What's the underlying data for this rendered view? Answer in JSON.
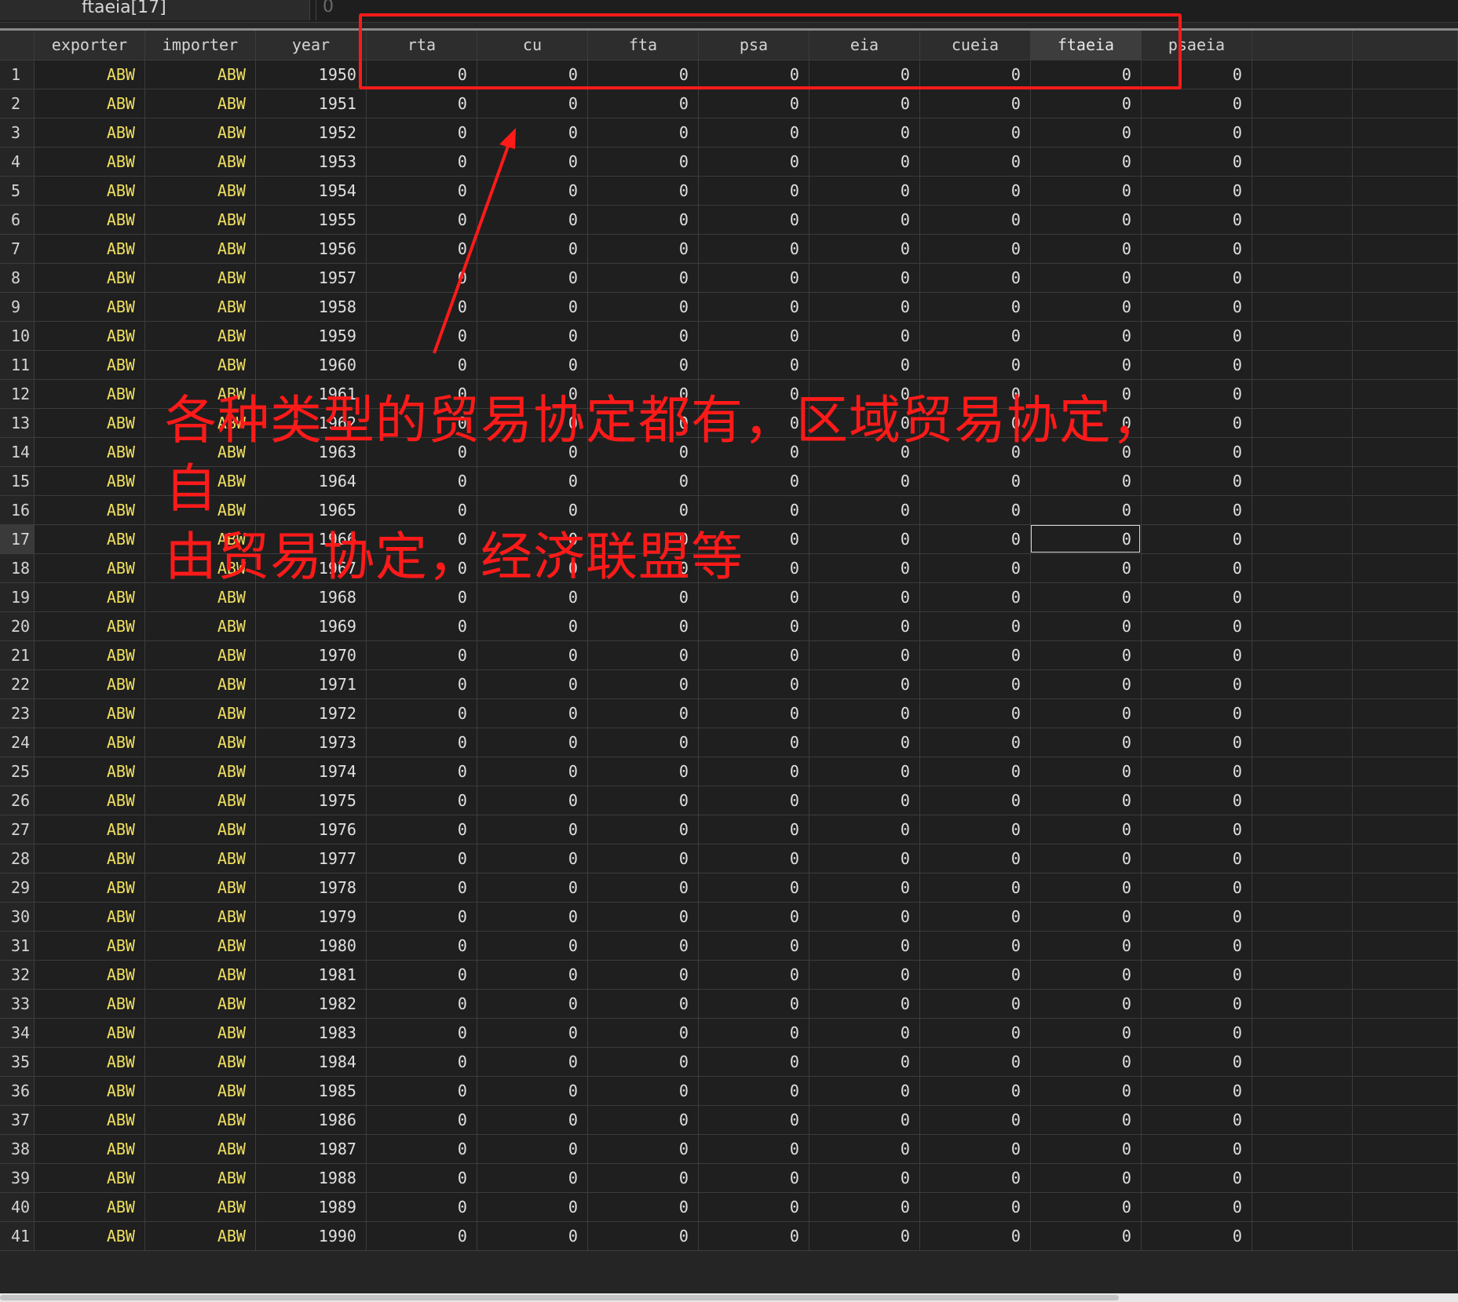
{
  "varname_label": "ftaeia[17]",
  "cell_value": "0",
  "columns": [
    "",
    "exporter",
    "importer",
    "year",
    "rta",
    "cu",
    "fta",
    "psa",
    "eia",
    "cueia",
    "ftaeia",
    "psaeia",
    "",
    ""
  ],
  "selected_column": "ftaeia",
  "selected_row": 17,
  "rows": [
    {
      "n": "1",
      "exporter": "ABW",
      "importer": "ABW",
      "year": "1950",
      "rta": "0",
      "cu": "0",
      "fta": "0",
      "psa": "0",
      "eia": "0",
      "cueia": "0",
      "ftaeia": "0",
      "psaeia": "0"
    },
    {
      "n": "2",
      "exporter": "ABW",
      "importer": "ABW",
      "year": "1951",
      "rta": "0",
      "cu": "0",
      "fta": "0",
      "psa": "0",
      "eia": "0",
      "cueia": "0",
      "ftaeia": "0",
      "psaeia": "0"
    },
    {
      "n": "3",
      "exporter": "ABW",
      "importer": "ABW",
      "year": "1952",
      "rta": "0",
      "cu": "0",
      "fta": "0",
      "psa": "0",
      "eia": "0",
      "cueia": "0",
      "ftaeia": "0",
      "psaeia": "0"
    },
    {
      "n": "4",
      "exporter": "ABW",
      "importer": "ABW",
      "year": "1953",
      "rta": "0",
      "cu": "0",
      "fta": "0",
      "psa": "0",
      "eia": "0",
      "cueia": "0",
      "ftaeia": "0",
      "psaeia": "0"
    },
    {
      "n": "5",
      "exporter": "ABW",
      "importer": "ABW",
      "year": "1954",
      "rta": "0",
      "cu": "0",
      "fta": "0",
      "psa": "0",
      "eia": "0",
      "cueia": "0",
      "ftaeia": "0",
      "psaeia": "0"
    },
    {
      "n": "6",
      "exporter": "ABW",
      "importer": "ABW",
      "year": "1955",
      "rta": "0",
      "cu": "0",
      "fta": "0",
      "psa": "0",
      "eia": "0",
      "cueia": "0",
      "ftaeia": "0",
      "psaeia": "0"
    },
    {
      "n": "7",
      "exporter": "ABW",
      "importer": "ABW",
      "year": "1956",
      "rta": "0",
      "cu": "0",
      "fta": "0",
      "psa": "0",
      "eia": "0",
      "cueia": "0",
      "ftaeia": "0",
      "psaeia": "0"
    },
    {
      "n": "8",
      "exporter": "ABW",
      "importer": "ABW",
      "year": "1957",
      "rta": "0",
      "cu": "0",
      "fta": "0",
      "psa": "0",
      "eia": "0",
      "cueia": "0",
      "ftaeia": "0",
      "psaeia": "0"
    },
    {
      "n": "9",
      "exporter": "ABW",
      "importer": "ABW",
      "year": "1958",
      "rta": "0",
      "cu": "0",
      "fta": "0",
      "psa": "0",
      "eia": "0",
      "cueia": "0",
      "ftaeia": "0",
      "psaeia": "0"
    },
    {
      "n": "10",
      "exporter": "ABW",
      "importer": "ABW",
      "year": "1959",
      "rta": "0",
      "cu": "0",
      "fta": "0",
      "psa": "0",
      "eia": "0",
      "cueia": "0",
      "ftaeia": "0",
      "psaeia": "0"
    },
    {
      "n": "11",
      "exporter": "ABW",
      "importer": "ABW",
      "year": "1960",
      "rta": "0",
      "cu": "0",
      "fta": "0",
      "psa": "0",
      "eia": "0",
      "cueia": "0",
      "ftaeia": "0",
      "psaeia": "0"
    },
    {
      "n": "12",
      "exporter": "ABW",
      "importer": "ABW",
      "year": "1961",
      "rta": "0",
      "cu": "0",
      "fta": "0",
      "psa": "0",
      "eia": "0",
      "cueia": "0",
      "ftaeia": "0",
      "psaeia": "0"
    },
    {
      "n": "13",
      "exporter": "ABW",
      "importer": "ABW",
      "year": "1962",
      "rta": "0",
      "cu": "0",
      "fta": "0",
      "psa": "0",
      "eia": "0",
      "cueia": "0",
      "ftaeia": "0",
      "psaeia": "0"
    },
    {
      "n": "14",
      "exporter": "ABW",
      "importer": "ABW",
      "year": "1963",
      "rta": "0",
      "cu": "0",
      "fta": "0",
      "psa": "0",
      "eia": "0",
      "cueia": "0",
      "ftaeia": "0",
      "psaeia": "0"
    },
    {
      "n": "15",
      "exporter": "ABW",
      "importer": "ABW",
      "year": "1964",
      "rta": "0",
      "cu": "0",
      "fta": "0",
      "psa": "0",
      "eia": "0",
      "cueia": "0",
      "ftaeia": "0",
      "psaeia": "0"
    },
    {
      "n": "16",
      "exporter": "ABW",
      "importer": "ABW",
      "year": "1965",
      "rta": "0",
      "cu": "0",
      "fta": "0",
      "psa": "0",
      "eia": "0",
      "cueia": "0",
      "ftaeia": "0",
      "psaeia": "0"
    },
    {
      "n": "17",
      "exporter": "ABW",
      "importer": "ABW",
      "year": "1966",
      "rta": "0",
      "cu": "0",
      "fta": "0",
      "psa": "0",
      "eia": "0",
      "cueia": "0",
      "ftaeia": "0",
      "psaeia": "0"
    },
    {
      "n": "18",
      "exporter": "ABW",
      "importer": "ABW",
      "year": "1967",
      "rta": "0",
      "cu": "0",
      "fta": "0",
      "psa": "0",
      "eia": "0",
      "cueia": "0",
      "ftaeia": "0",
      "psaeia": "0"
    },
    {
      "n": "19",
      "exporter": "ABW",
      "importer": "ABW",
      "year": "1968",
      "rta": "0",
      "cu": "0",
      "fta": "0",
      "psa": "0",
      "eia": "0",
      "cueia": "0",
      "ftaeia": "0",
      "psaeia": "0"
    },
    {
      "n": "20",
      "exporter": "ABW",
      "importer": "ABW",
      "year": "1969",
      "rta": "0",
      "cu": "0",
      "fta": "0",
      "psa": "0",
      "eia": "0",
      "cueia": "0",
      "ftaeia": "0",
      "psaeia": "0"
    },
    {
      "n": "21",
      "exporter": "ABW",
      "importer": "ABW",
      "year": "1970",
      "rta": "0",
      "cu": "0",
      "fta": "0",
      "psa": "0",
      "eia": "0",
      "cueia": "0",
      "ftaeia": "0",
      "psaeia": "0"
    },
    {
      "n": "22",
      "exporter": "ABW",
      "importer": "ABW",
      "year": "1971",
      "rta": "0",
      "cu": "0",
      "fta": "0",
      "psa": "0",
      "eia": "0",
      "cueia": "0",
      "ftaeia": "0",
      "psaeia": "0"
    },
    {
      "n": "23",
      "exporter": "ABW",
      "importer": "ABW",
      "year": "1972",
      "rta": "0",
      "cu": "0",
      "fta": "0",
      "psa": "0",
      "eia": "0",
      "cueia": "0",
      "ftaeia": "0",
      "psaeia": "0"
    },
    {
      "n": "24",
      "exporter": "ABW",
      "importer": "ABW",
      "year": "1973",
      "rta": "0",
      "cu": "0",
      "fta": "0",
      "psa": "0",
      "eia": "0",
      "cueia": "0",
      "ftaeia": "0",
      "psaeia": "0"
    },
    {
      "n": "25",
      "exporter": "ABW",
      "importer": "ABW",
      "year": "1974",
      "rta": "0",
      "cu": "0",
      "fta": "0",
      "psa": "0",
      "eia": "0",
      "cueia": "0",
      "ftaeia": "0",
      "psaeia": "0"
    },
    {
      "n": "26",
      "exporter": "ABW",
      "importer": "ABW",
      "year": "1975",
      "rta": "0",
      "cu": "0",
      "fta": "0",
      "psa": "0",
      "eia": "0",
      "cueia": "0",
      "ftaeia": "0",
      "psaeia": "0"
    },
    {
      "n": "27",
      "exporter": "ABW",
      "importer": "ABW",
      "year": "1976",
      "rta": "0",
      "cu": "0",
      "fta": "0",
      "psa": "0",
      "eia": "0",
      "cueia": "0",
      "ftaeia": "0",
      "psaeia": "0"
    },
    {
      "n": "28",
      "exporter": "ABW",
      "importer": "ABW",
      "year": "1977",
      "rta": "0",
      "cu": "0",
      "fta": "0",
      "psa": "0",
      "eia": "0",
      "cueia": "0",
      "ftaeia": "0",
      "psaeia": "0"
    },
    {
      "n": "29",
      "exporter": "ABW",
      "importer": "ABW",
      "year": "1978",
      "rta": "0",
      "cu": "0",
      "fta": "0",
      "psa": "0",
      "eia": "0",
      "cueia": "0",
      "ftaeia": "0",
      "psaeia": "0"
    },
    {
      "n": "30",
      "exporter": "ABW",
      "importer": "ABW",
      "year": "1979",
      "rta": "0",
      "cu": "0",
      "fta": "0",
      "psa": "0",
      "eia": "0",
      "cueia": "0",
      "ftaeia": "0",
      "psaeia": "0"
    },
    {
      "n": "31",
      "exporter": "ABW",
      "importer": "ABW",
      "year": "1980",
      "rta": "0",
      "cu": "0",
      "fta": "0",
      "psa": "0",
      "eia": "0",
      "cueia": "0",
      "ftaeia": "0",
      "psaeia": "0"
    },
    {
      "n": "32",
      "exporter": "ABW",
      "importer": "ABW",
      "year": "1981",
      "rta": "0",
      "cu": "0",
      "fta": "0",
      "psa": "0",
      "eia": "0",
      "cueia": "0",
      "ftaeia": "0",
      "psaeia": "0"
    },
    {
      "n": "33",
      "exporter": "ABW",
      "importer": "ABW",
      "year": "1982",
      "rta": "0",
      "cu": "0",
      "fta": "0",
      "psa": "0",
      "eia": "0",
      "cueia": "0",
      "ftaeia": "0",
      "psaeia": "0"
    },
    {
      "n": "34",
      "exporter": "ABW",
      "importer": "ABW",
      "year": "1983",
      "rta": "0",
      "cu": "0",
      "fta": "0",
      "psa": "0",
      "eia": "0",
      "cueia": "0",
      "ftaeia": "0",
      "psaeia": "0"
    },
    {
      "n": "35",
      "exporter": "ABW",
      "importer": "ABW",
      "year": "1984",
      "rta": "0",
      "cu": "0",
      "fta": "0",
      "psa": "0",
      "eia": "0",
      "cueia": "0",
      "ftaeia": "0",
      "psaeia": "0"
    },
    {
      "n": "36",
      "exporter": "ABW",
      "importer": "ABW",
      "year": "1985",
      "rta": "0",
      "cu": "0",
      "fta": "0",
      "psa": "0",
      "eia": "0",
      "cueia": "0",
      "ftaeia": "0",
      "psaeia": "0"
    },
    {
      "n": "37",
      "exporter": "ABW",
      "importer": "ABW",
      "year": "1986",
      "rta": "0",
      "cu": "0",
      "fta": "0",
      "psa": "0",
      "eia": "0",
      "cueia": "0",
      "ftaeia": "0",
      "psaeia": "0"
    },
    {
      "n": "38",
      "exporter": "ABW",
      "importer": "ABW",
      "year": "1987",
      "rta": "0",
      "cu": "0",
      "fta": "0",
      "psa": "0",
      "eia": "0",
      "cueia": "0",
      "ftaeia": "0",
      "psaeia": "0"
    },
    {
      "n": "39",
      "exporter": "ABW",
      "importer": "ABW",
      "year": "1988",
      "rta": "0",
      "cu": "0",
      "fta": "0",
      "psa": "0",
      "eia": "0",
      "cueia": "0",
      "ftaeia": "0",
      "psaeia": "0"
    },
    {
      "n": "40",
      "exporter": "ABW",
      "importer": "ABW",
      "year": "1989",
      "rta": "0",
      "cu": "0",
      "fta": "0",
      "psa": "0",
      "eia": "0",
      "cueia": "0",
      "ftaeia": "0",
      "psaeia": "0"
    },
    {
      "n": "41",
      "exporter": "ABW",
      "importer": "ABW",
      "year": "1990",
      "rta": "0",
      "cu": "0",
      "fta": "0",
      "psa": "0",
      "eia": "0",
      "cueia": "0",
      "ftaeia": "0",
      "psaeia": "0"
    }
  ],
  "annotation": {
    "line1": "各种类型的贸易协定都有，区域贸易协定，自",
    "line2": "由贸易协定，经济联盟等",
    "color": "#ff1a1a"
  },
  "colors": {
    "string_value": "#f0e060",
    "background": "#1f1f1f",
    "header": "#2d2d2d"
  }
}
